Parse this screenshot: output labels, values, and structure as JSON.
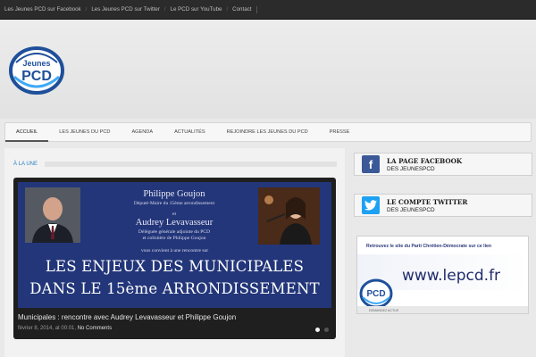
{
  "topbar": {
    "links": [
      "Les Jeunes PCD sur Facebook",
      "Les Jeunes PCD sur Twitter",
      "Le PCD sur YouTube",
      "Contact"
    ]
  },
  "logo": {
    "line1": "Jeunes",
    "line2": "PCD"
  },
  "nav": {
    "items": [
      "ACCUEIL",
      "LES JEUNES DU PCD",
      "AGENDA",
      "ACTUALITÉS",
      "REJOINDRE LES JEUNES DU PCD",
      "PRESSE"
    ],
    "active_index": 0
  },
  "main": {
    "section_title": "À LA UNE",
    "slide": {
      "poster": {
        "name1": "Philippe Goujon",
        "role1": "Député-Maire du 15ème arrondissement",
        "and": "et",
        "name2": "Audrey Levavasseur",
        "role2a": "Déléguée générale adjointe du PCD",
        "role2b": "et colistière de Philippe Goujon",
        "invite": "vous convient à une rencontre sur",
        "headline1": "LES ENJEUX DES MUNICIPALES",
        "headline2": "DANS LE 15ème ARRONDISSEMENT"
      },
      "caption": "Municipales : rencontre avec Audrey Levavasseur et Philippe Goujon",
      "date": "février 8, 2014, at 00:01,",
      "comments": "No Comments",
      "slide_count": 2,
      "current_slide": 1
    }
  },
  "sidebar": {
    "facebook": {
      "title": "LA PAGE FACEBOOK",
      "subtitle": "DES JEUNESPCD",
      "icon": "facebook-icon"
    },
    "twitter": {
      "title": "LE COMPTE TWITTER",
      "subtitle": "DES JEUNESPCD",
      "icon": "twitter-icon"
    },
    "banner": {
      "headline": "Retrouvez le site du Parti Chrétien-Démocrate sur ce lien",
      "url": "www.lepcd.fr",
      "logo_text": "PCD",
      "tag": "DEMANDEZ ACTUS"
    }
  },
  "colors": {
    "accent": "#2a7fc1",
    "facebook": "#3b5998",
    "twitter": "#1da1f2",
    "poster_bg": "#23367a"
  }
}
